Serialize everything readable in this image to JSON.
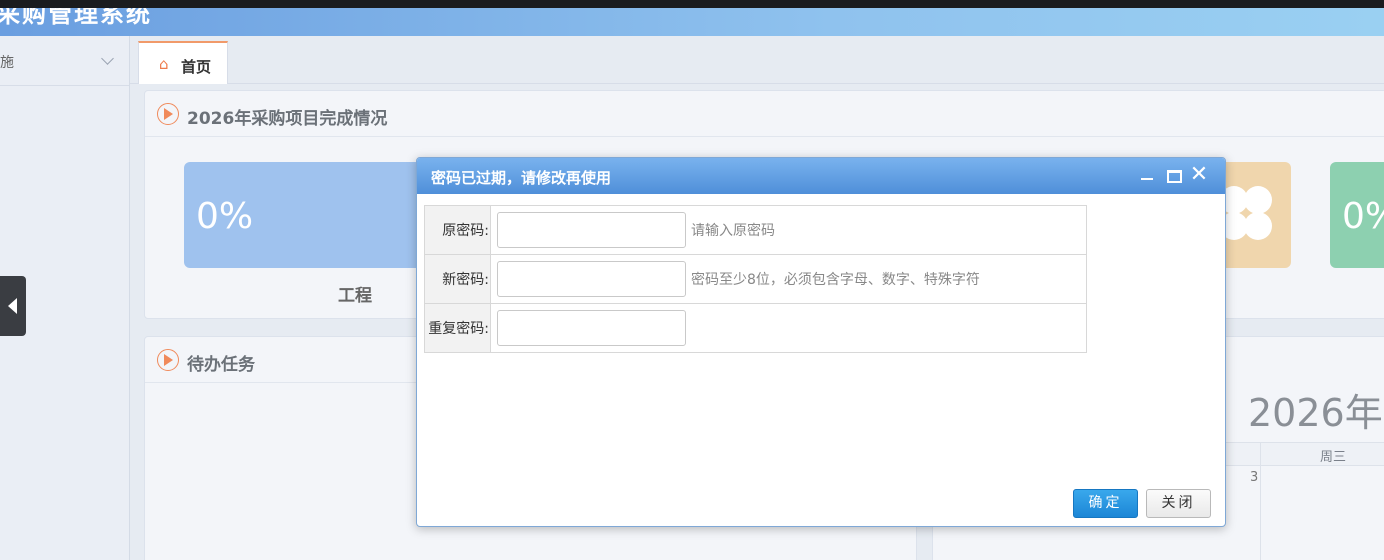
{
  "app": {
    "title": "采购管理系统"
  },
  "sidebar": {
    "section_label": "施"
  },
  "tabs": [
    {
      "label": "首页"
    }
  ],
  "panel_completion": {
    "title": "2026年采购项目完成情况",
    "cards": [
      {
        "value": "0%",
        "label": "工程",
        "color": "#9fc2ee"
      },
      {
        "value": "",
        "label": "",
        "color": "#f0d6ad"
      },
      {
        "value": "0%",
        "label": "",
        "color": "#8dd0b0"
      }
    ]
  },
  "panel_todo": {
    "title": "待办任务"
  },
  "calendar": {
    "year_label": "2026年",
    "weekday": "周三",
    "day": "3"
  },
  "dialog": {
    "title": "密码已过期，请修改再使用",
    "fields": [
      {
        "label": "原密码:",
        "value": "",
        "hint": "请输入原密码"
      },
      {
        "label": "新密码:",
        "value": "",
        "hint": "密码至少8位，必须包含字母、数字、特殊字符"
      },
      {
        "label": "重复密码:",
        "value": "",
        "hint": ""
      }
    ],
    "ok_label": "确定",
    "close_label": "关闭"
  }
}
